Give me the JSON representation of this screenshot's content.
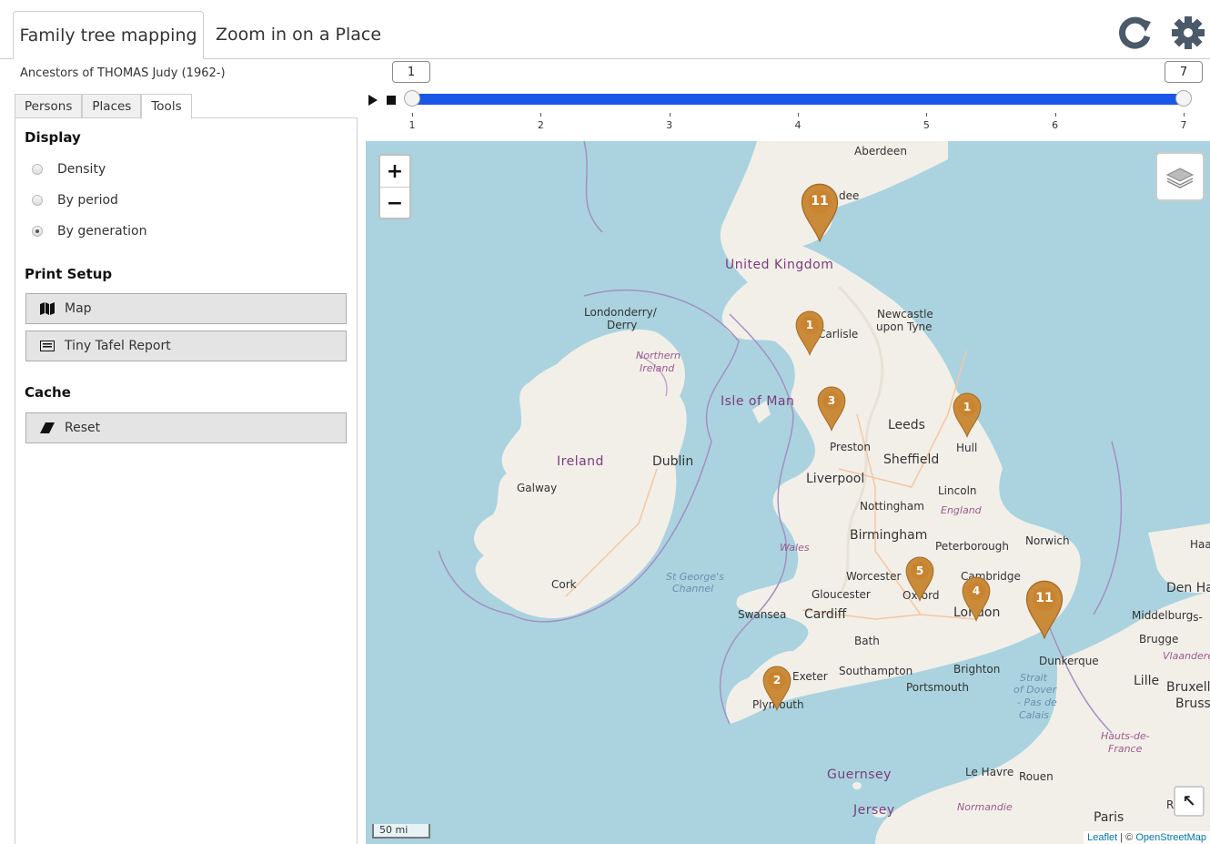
{
  "tabs": [
    {
      "label": "Family tree mapping"
    },
    {
      "label": "Zoom in on a Place"
    }
  ],
  "title": "Ancestors of THOMAS Judy (1962-)",
  "side_tabs": [
    {
      "label": "Persons"
    },
    {
      "label": "Places"
    },
    {
      "label": "Tools"
    }
  ],
  "tools": {
    "display_heading": "Display",
    "display_options": [
      {
        "label": "Density",
        "checked": false
      },
      {
        "label": "By period",
        "checked": false
      },
      {
        "label": "By generation",
        "checked": true
      }
    ],
    "print_heading": "Print Setup",
    "print_map": "Map",
    "print_tafel": "Tiny Tafel Report",
    "cache_heading": "Cache",
    "cache_reset": "Reset"
  },
  "slider": {
    "min_value": "1",
    "max_value": "7",
    "ticks": [
      "1",
      "2",
      "3",
      "4",
      "5",
      "6",
      "7"
    ]
  },
  "map": {
    "zoom_in": "+",
    "zoom_out": "−",
    "scale": "50 mi",
    "attribution_leaflet": "Leaflet",
    "attribution_sep": " | © ",
    "attribution_osm": "OpenStreetMap",
    "marker_color": "#c98a3a",
    "markers": [
      {
        "count": "11"
      },
      {
        "count": "1"
      },
      {
        "count": "3"
      },
      {
        "count": "1"
      },
      {
        "count": "5"
      },
      {
        "count": "4"
      },
      {
        "count": "11"
      },
      {
        "count": "2"
      }
    ],
    "places": {
      "aberdeen": "Aberdeen",
      "dundee": "dee",
      "uk": "United Kingdom",
      "londonderry": "Londonderry/",
      "derry": "Derry",
      "northern": "Northern",
      "ireland_ni": "Ireland",
      "carlisle": "Carlisle",
      "newcastle": "Newcastle",
      "upon_tyne": "upon Tyne",
      "isle_of_man": "Isle of Man",
      "leeds": "Leeds",
      "preston": "Preston",
      "hull": "Hull",
      "sheffield": "Sheffield",
      "liverpool": "Liverpool",
      "ireland": "Ireland",
      "dublin": "Dublin",
      "galway": "Galway",
      "lincoln": "Lincoln",
      "nottingham": "Nottingham",
      "england": "England",
      "birmingham": "Birmingham",
      "wales": "Wales",
      "peterborough": "Peterborough",
      "norwich": "Norwich",
      "haa": "Haa",
      "cork": "Cork",
      "st_georges": "St George's",
      "channel": "Channel",
      "worcester": "Worcester",
      "cambridge": "Cambridge",
      "gloucester": "Gloucester",
      "oxford": "Oxford",
      "den_ha": "Den Ha",
      "swansea": "Swansea",
      "cardiff": "Cardiff",
      "london": "London",
      "middelburg": "Middelburg",
      "s": "'s-",
      "bath": "Bath",
      "brugge": "Brugge",
      "vlaandere": "Vlaandere",
      "dunkerque": "Dunkerque",
      "exeter": "Exeter",
      "southampton": "Southampton",
      "brighton": "Brighton",
      "lille": "Lille",
      "bruxell": "Bruxell",
      "bruss": "Bruss",
      "strait": "Strait",
      "of_dover": "of Dover",
      "pas_de": "- Pas de",
      "calais": "Calais",
      "portsmouth": "Portsmouth",
      "plymouth": "Plymouth",
      "hauts": "Hauts-de-",
      "france": "France",
      "guernsey": "Guernsey",
      "le_havre": "Le Havre",
      "rouen": "Rouen",
      "jersey": "Jersey",
      "normandie": "Normandie",
      "paris": "Paris",
      "re": "Re"
    }
  }
}
